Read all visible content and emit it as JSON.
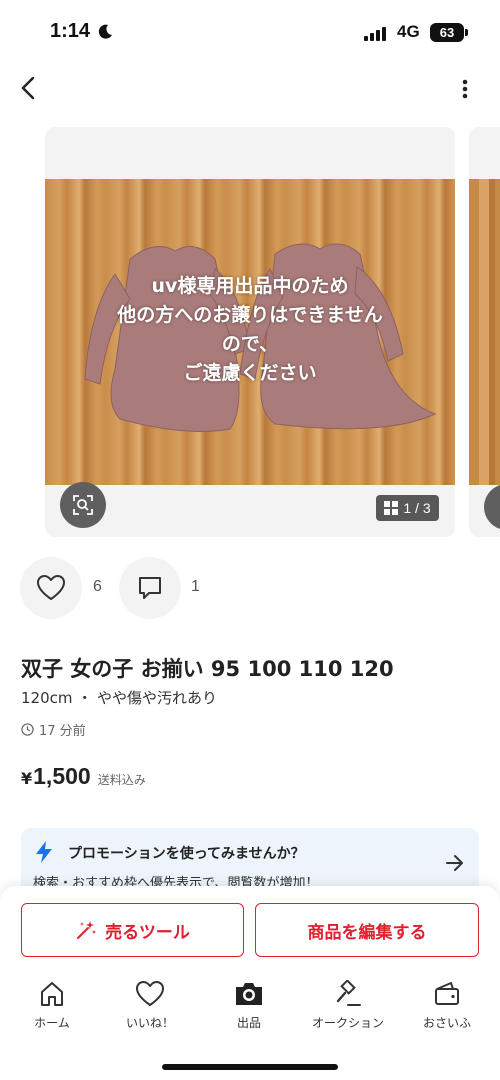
{
  "status_bar": {
    "time": "1:14",
    "network": "4G",
    "battery": "63"
  },
  "listing": {
    "image_overlay_lines": [
      "uv様専用出品中のため",
      "他の方へのお譲りはできません",
      "ので、",
      "ご遠慮ください"
    ],
    "image_counter": "1 / 3",
    "likes": "6",
    "comments": "1",
    "title": "双子 女の子 お揃い 95 100 110 120",
    "subtitle": "120cm ・ やや傷や汚れあり",
    "posted": "17 分前",
    "price_yen_symbol": "¥",
    "price": "1,500",
    "shipping_note": "送料込み"
  },
  "promo": {
    "title": "プロモーションを使ってみませんか？",
    "description": "検索・おすすめ枠へ優先表示で、閲覧数が増加！"
  },
  "actions": {
    "sell_tools_label": "売るツール",
    "edit_label": "商品を編集する"
  },
  "tabs": [
    {
      "label": "ホーム",
      "icon": "home-icon"
    },
    {
      "label": "いいね！",
      "icon": "heart-icon"
    },
    {
      "label": "出品",
      "icon": "camera-icon"
    },
    {
      "label": "オークション",
      "icon": "gavel-icon"
    },
    {
      "label": "おさいふ",
      "icon": "wallet-icon"
    }
  ],
  "colors": {
    "accent": "#e0202f",
    "promo_bg": "#eef4fb",
    "promo_icon": "#1a73e8"
  }
}
